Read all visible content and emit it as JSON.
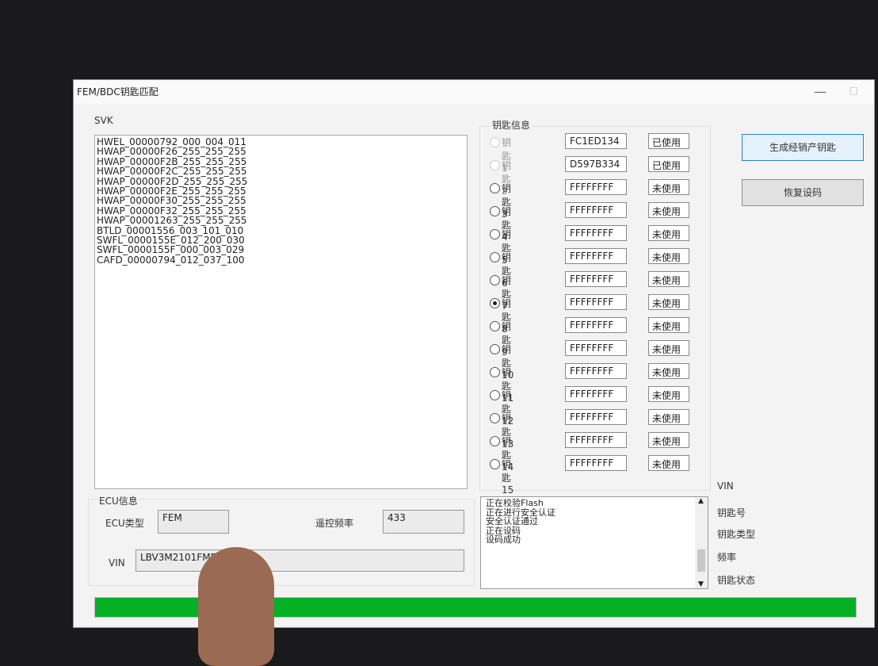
{
  "window": {
    "title": "FEM/BDC钥匙匹配",
    "minimize": "—",
    "maximize": "□"
  },
  "svk": {
    "label": "SVK",
    "lines": [
      "HWEL_00000792_000_004_011",
      "HWAP_00000F26_255_255_255",
      "HWAP_00000F2B_255_255_255",
      "HWAP_00000F2C_255_255_255",
      "HWAP_00000F2D_255_255_255",
      "HWAP_00000F2E_255_255_255",
      "HWAP_00000F30_255_255_255",
      "HWAP_00000F32_255_255_255",
      "HWAP_00001263_255_255_255",
      "BTLD_00001556_003_101_010",
      "SWFL_0000155E_012_200_030",
      "SWFL_0000155F_000_003_029",
      "CAFD_00000794_012_037_100"
    ]
  },
  "keyinfo": {
    "label": "钥匙信息",
    "keys": [
      {
        "label": "钥匙1",
        "id": "FC1ED134",
        "status": "已使用",
        "checked": false,
        "disabled": true
      },
      {
        "label": "钥匙2",
        "id": "D597B334",
        "status": "已使用",
        "checked": false,
        "disabled": true
      },
      {
        "label": "钥匙3",
        "id": "FFFFFFFF",
        "status": "未使用",
        "checked": false,
        "disabled": false
      },
      {
        "label": "钥匙4",
        "id": "FFFFFFFF",
        "status": "未使用",
        "checked": false,
        "disabled": false
      },
      {
        "label": "钥匙5",
        "id": "FFFFFFFF",
        "status": "未使用",
        "checked": false,
        "disabled": false
      },
      {
        "label": "钥匙6",
        "id": "FFFFFFFF",
        "status": "未使用",
        "checked": false,
        "disabled": false
      },
      {
        "label": "钥匙7",
        "id": "FFFFFFFF",
        "status": "未使用",
        "checked": false,
        "disabled": false
      },
      {
        "label": "钥匙8",
        "id": "FFFFFFFF",
        "status": "未使用",
        "checked": true,
        "disabled": false
      },
      {
        "label": "钥匙9",
        "id": "FFFFFFFF",
        "status": "未使用",
        "checked": false,
        "disabled": false
      },
      {
        "label": "钥匙10",
        "id": "FFFFFFFF",
        "status": "未使用",
        "checked": false,
        "disabled": false
      },
      {
        "label": "钥匙11",
        "id": "FFFFFFFF",
        "status": "未使用",
        "checked": false,
        "disabled": false
      },
      {
        "label": "钥匙12",
        "id": "FFFFFFFF",
        "status": "未使用",
        "checked": false,
        "disabled": false
      },
      {
        "label": "钥匙13",
        "id": "FFFFFFFF",
        "status": "未使用",
        "checked": false,
        "disabled": false
      },
      {
        "label": "钥匙14",
        "id": "FFFFFFFF",
        "status": "未使用",
        "checked": false,
        "disabled": false
      },
      {
        "label": "钥匙15",
        "id": "FFFFFFFF",
        "status": "未使用",
        "checked": false,
        "disabled": false
      }
    ]
  },
  "buttons": {
    "generate": "生成经销产钥匙",
    "restore": "恢复设码"
  },
  "ecu": {
    "group_label": "ECU信息",
    "type_label": "ECU类型",
    "type_value": "FEM",
    "freq_label": "遥控频率",
    "freq_value": "433",
    "vin_label": "VIN",
    "vin_value": "LBV3M2101FMF"
  },
  "log": {
    "lines": [
      "正在校验Flash",
      "正在进行安全认证",
      "安全认证通过",
      "正在设码",
      "设码成功"
    ]
  },
  "info_labels": {
    "vin": "VIN",
    "key_no": "钥匙号",
    "key_type": "钥匙类型",
    "freq": "频率",
    "key_status": "钥匙状态"
  },
  "progress": {
    "value": 100,
    "color": "#06b025"
  }
}
